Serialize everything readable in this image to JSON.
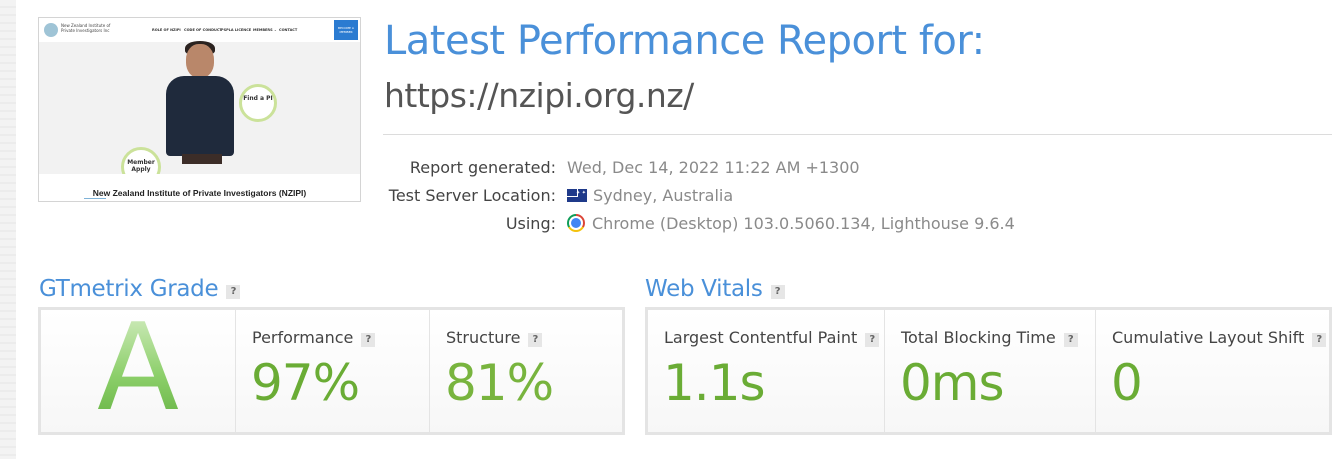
{
  "thumbnail": {
    "logo_text": "New Zealand Institute of Private Investigators Inc",
    "menu": [
      "ROLE OF NZIPI",
      "CODE OF CONDUCT",
      "PSPLA LICENCE",
      "MEMBERS ⌄",
      "CONTACT"
    ],
    "cta": "BECOME A MEMBER",
    "circle_find": "Find a PI",
    "circle_member": "Member Apply",
    "site_title": "New Zealand Institute of Private Investigators (NZIPI)"
  },
  "header": {
    "title": "Latest Performance Report for:",
    "url": "https://nzipi.org.nz/"
  },
  "meta": {
    "generated_label": "Report generated:",
    "generated_value": "Wed, Dec 14, 2022 11:22 AM +1300",
    "location_label": "Test Server Location:",
    "location_value": "Sydney, Australia",
    "location_flag": "australia-flag",
    "using_label": "Using:",
    "using_value": "Chrome (Desktop) 103.0.5060.134, Lighthouse 9.6.4",
    "using_icon": "chrome-icon"
  },
  "grade": {
    "title": "GTmetrix Grade",
    "help": "?",
    "letter": "A",
    "performance_label": "Performance",
    "performance_value": "97%",
    "structure_label": "Structure",
    "structure_value": "81%"
  },
  "vitals": {
    "title": "Web Vitals",
    "help": "?",
    "lcp_label": "Largest Contentful Paint",
    "lcp_value": "1.1s",
    "tbt_label": "Total Blocking Time",
    "tbt_value": "0ms",
    "cls_label": "Cumulative Layout Shift",
    "cls_value": "0"
  },
  "colors": {
    "heading_blue": "#4a90d9",
    "value_green": "#6aac35",
    "grade_green": "#7cbf5a"
  }
}
